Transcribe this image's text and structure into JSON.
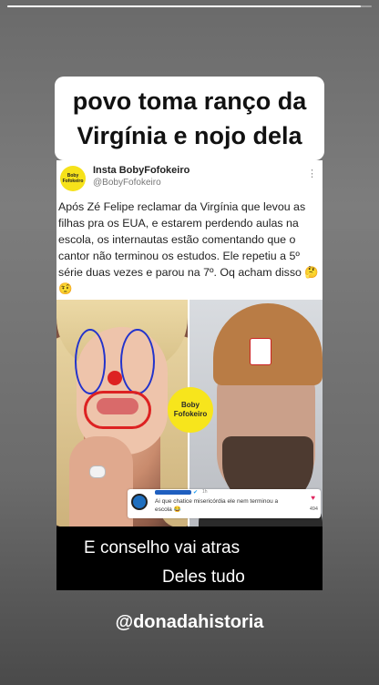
{
  "story": {
    "progress": 0.97
  },
  "headline": {
    "text": "povo toma ranço da Virgínia e nojo dela"
  },
  "post": {
    "logo_text_1": "Boby",
    "logo_text_2": "Fofokeiro",
    "author_name": "Insta BobyFofokeiro",
    "author_handle": "@BobyFofokeiro",
    "more_icon": "⋮",
    "body": "Após Zé Felipe reclamar da Virgínia que levou as filhas pra os EUA, e estarem perdendo aulas na escola, os internautas estão comentando que o cantor não terminou os estudos. Ele repetiu a 5º série duas vezes e parou na 7º. Oq acham disso 🤔🤨"
  },
  "media": {
    "badge_line_1": "Boby",
    "badge_line_2": "Fofokeiro",
    "comment": {
      "verified_icon": "✔",
      "time": "1h",
      "text": "Ai que chatice misericórdia ele nem terminou a escola 😂",
      "heart_icon": "♥",
      "likes": "494"
    }
  },
  "caption": {
    "line_1": "E conselho vai atras",
    "line_2": "Deles tudo"
  },
  "account_tag": "@donadahistoria"
}
